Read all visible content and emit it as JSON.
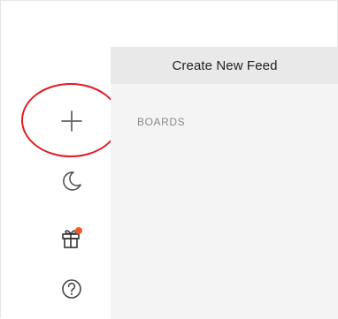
{
  "panel": {
    "header_title": "Create New Feed",
    "section_label": "BOARDS"
  },
  "sidebar": {
    "icons": [
      {
        "name": "plus-icon",
        "label": "Add"
      },
      {
        "name": "moon-icon",
        "label": "Night mode"
      },
      {
        "name": "gift-icon",
        "label": "Gifts",
        "badge": "notification-dot"
      },
      {
        "name": "help-icon",
        "label": "Help"
      }
    ]
  },
  "colors": {
    "annotation_circle": "#e01b24",
    "badge": "#f05a28",
    "icon": "#555555",
    "panel_bg": "#f4f4f4",
    "panel_header_bg": "#e9e9e9",
    "section_label": "#8a8a8a"
  }
}
